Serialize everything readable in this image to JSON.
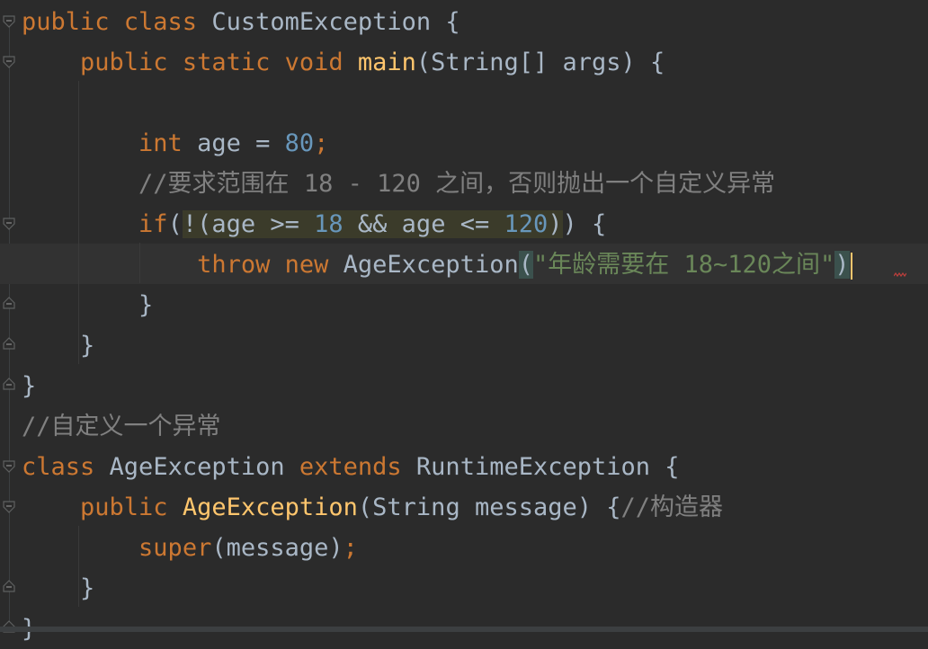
{
  "editor": {
    "lines": [
      {
        "tokens": [
          [
            "kw",
            "public class "
          ],
          [
            "plain",
            "CustomException {"
          ]
        ]
      },
      {
        "tokens": [
          [
            "plain",
            "    "
          ],
          [
            "kw",
            "public static void "
          ],
          [
            "fn",
            "main"
          ],
          [
            "plain",
            "(String[] args) {"
          ]
        ]
      },
      {
        "tokens": [
          [
            "plain",
            ""
          ]
        ]
      },
      {
        "tokens": [
          [
            "plain",
            "        "
          ],
          [
            "kw",
            "int "
          ],
          [
            "plain",
            "age = "
          ],
          [
            "num",
            "80"
          ],
          [
            "kw",
            ";"
          ]
        ]
      },
      {
        "tokens": [
          [
            "plain",
            "        "
          ],
          [
            "cmt",
            "//要求范围在 18 - 120 之间，否则抛出一个自定义异常"
          ]
        ]
      },
      {
        "tokens": [
          [
            "plain",
            "        "
          ],
          [
            "kw",
            "if"
          ],
          [
            "plain",
            "("
          ],
          [
            "hl",
            "!(age >= "
          ],
          [
            "hlnum",
            "18"
          ],
          [
            "hl",
            " && age <= "
          ],
          [
            "hlnum",
            "120"
          ],
          [
            "hl",
            ")"
          ],
          [
            "plain",
            ") {"
          ]
        ]
      },
      {
        "tokens": [
          [
            "plain",
            "            "
          ],
          [
            "kw",
            "throw new "
          ],
          [
            "plain",
            "AgeException"
          ],
          [
            "brace",
            "("
          ],
          [
            "str",
            "\"年龄需要在 18~120之间\""
          ],
          [
            "brace",
            ")"
          ],
          [
            "cursor",
            ""
          ]
        ]
      },
      {
        "tokens": [
          [
            "plain",
            "        }"
          ]
        ]
      },
      {
        "tokens": [
          [
            "plain",
            "    }"
          ]
        ]
      },
      {
        "tokens": [
          [
            "plain",
            "}"
          ]
        ]
      },
      {
        "tokens": [
          [
            "cmt",
            "//自定义一个异常"
          ]
        ]
      },
      {
        "tokens": [
          [
            "kw",
            "class "
          ],
          [
            "plain",
            "AgeException "
          ],
          [
            "kw",
            "extends "
          ],
          [
            "plain",
            "RuntimeException {"
          ]
        ]
      },
      {
        "tokens": [
          [
            "plain",
            "    "
          ],
          [
            "kw",
            "public "
          ],
          [
            "fn",
            "AgeException"
          ],
          [
            "plain",
            "(String message) {"
          ],
          [
            "cmt",
            "//构造器"
          ]
        ]
      },
      {
        "tokens": [
          [
            "plain",
            "        "
          ],
          [
            "kw",
            "super"
          ],
          [
            "plain",
            "(message)"
          ],
          [
            "kw",
            ";"
          ]
        ]
      },
      {
        "tokens": [
          [
            "plain",
            "    }"
          ]
        ]
      },
      {
        "tokens": [
          [
            "plain",
            "}"
          ]
        ]
      }
    ]
  },
  "colors": {
    "background": "#2b2b2b",
    "keyword": "#cc7832",
    "function": "#ffc66d",
    "number": "#6897bb",
    "string": "#6a8759",
    "comment": "#808080",
    "text": "#a9b7c6",
    "highlight": "#3b3b2a",
    "brace_match": "#3b514d"
  },
  "icons": [
    "fold-open-icon",
    "fold-close-icon",
    "error-squiggle-icon"
  ]
}
